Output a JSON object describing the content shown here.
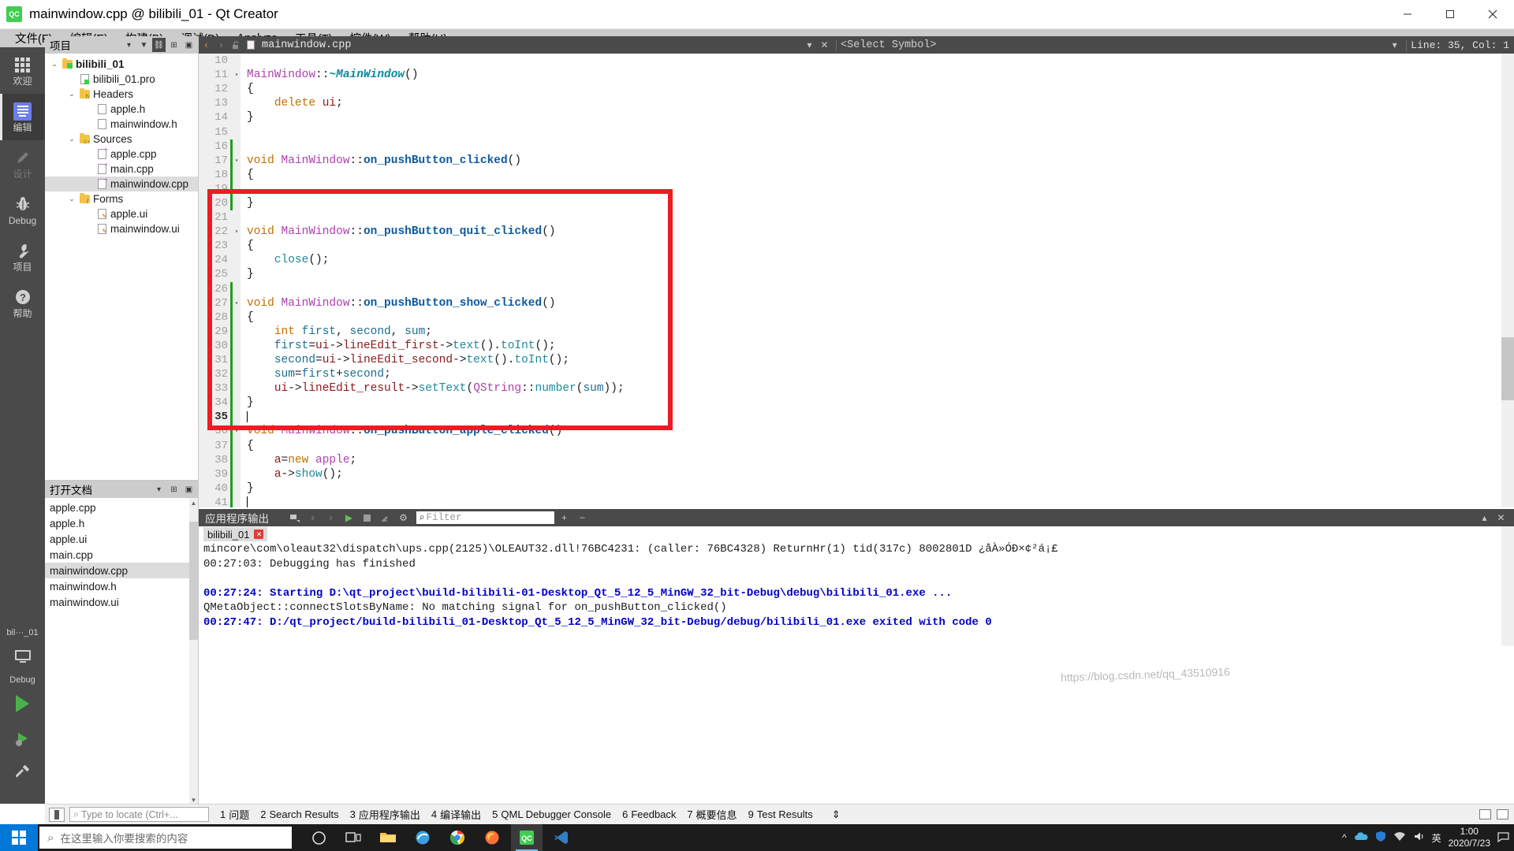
{
  "window": {
    "title": "mainwindow.cpp @ bilibili_01 - Qt Creator",
    "logo_text": "QC",
    "minimize": "—",
    "maximize": "□",
    "close": "✕"
  },
  "menubar": [
    {
      "label": "文件(F)",
      "mnemonic": "F"
    },
    {
      "label": "编辑(E)",
      "mnemonic": "E"
    },
    {
      "label": "构建(B)",
      "mnemonic": "B"
    },
    {
      "label": "调试(D)",
      "mnemonic": "D"
    },
    {
      "label": "Analyze",
      "mnemonic": "A"
    },
    {
      "label": "工具(T)",
      "mnemonic": "T"
    },
    {
      "label": "控件(W)",
      "mnemonic": "W"
    },
    {
      "label": "帮助(H)",
      "mnemonic": "H"
    }
  ],
  "modebar": {
    "items": [
      {
        "label": "欢迎",
        "icon": "grid-icon",
        "state": "normal"
      },
      {
        "label": "编辑",
        "icon": "document-lines-icon",
        "state": "active"
      },
      {
        "label": "设计",
        "icon": "pencil-icon",
        "state": "disabled"
      },
      {
        "label": "Debug",
        "icon": "bug-icon",
        "state": "normal"
      },
      {
        "label": "项目",
        "icon": "wrench-icon",
        "state": "normal"
      },
      {
        "label": "帮助",
        "icon": "question-circle-icon",
        "state": "normal"
      }
    ],
    "kit_label": "bil···_01",
    "kit_mode": "Debug"
  },
  "project_panel": {
    "header": "项目",
    "tools": [
      "filter-icon",
      "link-icon",
      "split-icon",
      "collapse-icon"
    ],
    "tree": [
      {
        "label": "bilibili_01",
        "depth": 0,
        "icon": "qt-folder-icon",
        "expander": "open",
        "bold": true,
        "selected": false
      },
      {
        "label": "bilibili_01.pro",
        "depth": 1,
        "icon": "pro-file-icon",
        "expander": "none",
        "bold": false,
        "selected": false
      },
      {
        "label": "Headers",
        "depth": 1,
        "icon": "h-folder-icon",
        "expander": "open",
        "bold": false,
        "selected": false
      },
      {
        "label": "apple.h",
        "depth": 2,
        "icon": "header-file-icon",
        "expander": "none",
        "bold": false,
        "selected": false
      },
      {
        "label": "mainwindow.h",
        "depth": 2,
        "icon": "header-file-icon",
        "expander": "none",
        "bold": false,
        "selected": false
      },
      {
        "label": "Sources",
        "depth": 1,
        "icon": "cpp-folder-icon",
        "expander": "open",
        "bold": false,
        "selected": false
      },
      {
        "label": "apple.cpp",
        "depth": 2,
        "icon": "cpp-file-icon",
        "expander": "none",
        "bold": false,
        "selected": false
      },
      {
        "label": "main.cpp",
        "depth": 2,
        "icon": "cpp-file-icon",
        "expander": "none",
        "bold": false,
        "selected": false
      },
      {
        "label": "mainwindow.cpp",
        "depth": 2,
        "icon": "cpp-file-icon",
        "expander": "none",
        "bold": false,
        "selected": true
      },
      {
        "label": "Forms",
        "depth": 1,
        "icon": "forms-folder-icon",
        "expander": "open",
        "bold": false,
        "selected": false
      },
      {
        "label": "apple.ui",
        "depth": 2,
        "icon": "ui-file-icon",
        "expander": "none",
        "bold": false,
        "selected": false
      },
      {
        "label": "mainwindow.ui",
        "depth": 2,
        "icon": "ui-file-icon",
        "expander": "none",
        "bold": false,
        "selected": false
      }
    ]
  },
  "open_documents": {
    "header": "打开文档",
    "items": [
      {
        "label": "apple.cpp",
        "selected": false
      },
      {
        "label": "apple.h",
        "selected": false
      },
      {
        "label": "apple.ui",
        "selected": false
      },
      {
        "label": "main.cpp",
        "selected": false
      },
      {
        "label": "mainwindow.cpp",
        "selected": true
      },
      {
        "label": "mainwindow.h",
        "selected": false
      },
      {
        "label": "mainwindow.ui",
        "selected": false
      }
    ]
  },
  "editor_toolbar": {
    "back": "‹",
    "forward": "›",
    "lock_icon": "unlocked-icon",
    "file_icon": "cpp-file-icon",
    "filename": "mainwindow.cpp",
    "dropdown": "▾",
    "close": "✕",
    "symbol_selector": "<Select Symbol>",
    "symbol_dropdown": "▾",
    "cursor_position": "Line: 35, Col: 1"
  },
  "code": {
    "lines": [
      {
        "num": 10,
        "fold": "",
        "changed": false,
        "tokens": []
      },
      {
        "num": 11,
        "fold": "▾",
        "changed": false,
        "tokens": [
          {
            "t": "MainWindow",
            "c": "cls"
          },
          {
            "t": "::",
            "c": "pn"
          },
          {
            "t": "~MainWindow",
            "c": "fni"
          },
          {
            "t": "()",
            "c": "pn"
          }
        ]
      },
      {
        "num": 12,
        "fold": "",
        "changed": false,
        "tokens": [
          {
            "t": "{",
            "c": "pn"
          }
        ]
      },
      {
        "num": 13,
        "fold": "",
        "changed": false,
        "tokens": [
          {
            "t": "    ",
            "c": "pn"
          },
          {
            "t": "delete",
            "c": "k"
          },
          {
            "t": " ",
            "c": "pn"
          },
          {
            "t": "ui",
            "c": "mem"
          },
          {
            "t": ";",
            "c": "pn"
          }
        ]
      },
      {
        "num": 14,
        "fold": "",
        "changed": false,
        "tokens": [
          {
            "t": "}",
            "c": "pn"
          }
        ]
      },
      {
        "num": 15,
        "fold": "",
        "changed": false,
        "tokens": []
      },
      {
        "num": 16,
        "fold": "",
        "changed": true,
        "tokens": []
      },
      {
        "num": 17,
        "fold": "▾",
        "changed": true,
        "tokens": [
          {
            "t": "void",
            "c": "k"
          },
          {
            "t": " ",
            "c": "pn"
          },
          {
            "t": "MainWindow",
            "c": "cls"
          },
          {
            "t": "::",
            "c": "pn"
          },
          {
            "t": "on_pushButton_clicked",
            "c": "fn"
          },
          {
            "t": "()",
            "c": "pn"
          }
        ]
      },
      {
        "num": 18,
        "fold": "",
        "changed": true,
        "tokens": [
          {
            "t": "{",
            "c": "pn"
          }
        ]
      },
      {
        "num": 19,
        "fold": "",
        "changed": true,
        "tokens": []
      },
      {
        "num": 20,
        "fold": "",
        "changed": true,
        "tokens": [
          {
            "t": "}",
            "c": "pn"
          }
        ]
      },
      {
        "num": 21,
        "fold": "",
        "changed": false,
        "tokens": []
      },
      {
        "num": 22,
        "fold": "▾",
        "changed": false,
        "tokens": [
          {
            "t": "void",
            "c": "k"
          },
          {
            "t": " ",
            "c": "pn"
          },
          {
            "t": "MainWindow",
            "c": "cls"
          },
          {
            "t": "::",
            "c": "pn"
          },
          {
            "t": "on_pushButton_quit_clicked",
            "c": "fn"
          },
          {
            "t": "()",
            "c": "pn"
          }
        ]
      },
      {
        "num": 23,
        "fold": "",
        "changed": false,
        "tokens": [
          {
            "t": "{",
            "c": "pn"
          }
        ]
      },
      {
        "num": 24,
        "fold": "",
        "changed": false,
        "tokens": [
          {
            "t": "    ",
            "c": "pn"
          },
          {
            "t": "close",
            "c": "cal"
          },
          {
            "t": "();",
            "c": "pn"
          }
        ]
      },
      {
        "num": 25,
        "fold": "",
        "changed": false,
        "tokens": [
          {
            "t": "}",
            "c": "pn"
          }
        ]
      },
      {
        "num": 26,
        "fold": "",
        "changed": true,
        "tokens": []
      },
      {
        "num": 27,
        "fold": "▾",
        "changed": true,
        "tokens": [
          {
            "t": "void",
            "c": "k"
          },
          {
            "t": " ",
            "c": "pn"
          },
          {
            "t": "MainWindow",
            "c": "cls"
          },
          {
            "t": "::",
            "c": "pn"
          },
          {
            "t": "on_pushButton_show_clicked",
            "c": "fn"
          },
          {
            "t": "()",
            "c": "pn"
          }
        ]
      },
      {
        "num": 28,
        "fold": "",
        "changed": true,
        "tokens": [
          {
            "t": "{",
            "c": "pn"
          }
        ]
      },
      {
        "num": 29,
        "fold": "",
        "changed": true,
        "tokens": [
          {
            "t": "    ",
            "c": "pn"
          },
          {
            "t": "int",
            "c": "k"
          },
          {
            "t": " ",
            "c": "pn"
          },
          {
            "t": "first",
            "c": "loc"
          },
          {
            "t": ", ",
            "c": "pn"
          },
          {
            "t": "second",
            "c": "loc"
          },
          {
            "t": ", ",
            "c": "pn"
          },
          {
            "t": "sum",
            "c": "loc"
          },
          {
            "t": ";",
            "c": "pn"
          }
        ]
      },
      {
        "num": 30,
        "fold": "",
        "changed": true,
        "tokens": [
          {
            "t": "    ",
            "c": "pn"
          },
          {
            "t": "first",
            "c": "loc"
          },
          {
            "t": "=",
            "c": "pn"
          },
          {
            "t": "ui",
            "c": "mem"
          },
          {
            "t": "->",
            "c": "pn"
          },
          {
            "t": "lineEdit_first",
            "c": "mem"
          },
          {
            "t": "->",
            "c": "pn"
          },
          {
            "t": "text",
            "c": "cal"
          },
          {
            "t": "().",
            "c": "pn"
          },
          {
            "t": "toInt",
            "c": "cal"
          },
          {
            "t": "();",
            "c": "pn"
          }
        ]
      },
      {
        "num": 31,
        "fold": "",
        "changed": true,
        "tokens": [
          {
            "t": "    ",
            "c": "pn"
          },
          {
            "t": "second",
            "c": "loc"
          },
          {
            "t": "=",
            "c": "pn"
          },
          {
            "t": "ui",
            "c": "mem"
          },
          {
            "t": "->",
            "c": "pn"
          },
          {
            "t": "lineEdit_second",
            "c": "mem"
          },
          {
            "t": "->",
            "c": "pn"
          },
          {
            "t": "text",
            "c": "cal"
          },
          {
            "t": "().",
            "c": "pn"
          },
          {
            "t": "toInt",
            "c": "cal"
          },
          {
            "t": "();",
            "c": "pn"
          }
        ]
      },
      {
        "num": 32,
        "fold": "",
        "changed": true,
        "tokens": [
          {
            "t": "    ",
            "c": "pn"
          },
          {
            "t": "sum",
            "c": "loc"
          },
          {
            "t": "=",
            "c": "pn"
          },
          {
            "t": "first",
            "c": "loc"
          },
          {
            "t": "+",
            "c": "pn"
          },
          {
            "t": "second",
            "c": "loc"
          },
          {
            "t": ";",
            "c": "pn"
          }
        ]
      },
      {
        "num": 33,
        "fold": "",
        "changed": true,
        "tokens": [
          {
            "t": "    ",
            "c": "pn"
          },
          {
            "t": "ui",
            "c": "mem"
          },
          {
            "t": "->",
            "c": "pn"
          },
          {
            "t": "lineEdit_result",
            "c": "mem"
          },
          {
            "t": "->",
            "c": "pn"
          },
          {
            "t": "setText",
            "c": "cal"
          },
          {
            "t": "(",
            "c": "pn"
          },
          {
            "t": "QString",
            "c": "cls"
          },
          {
            "t": "::",
            "c": "pn"
          },
          {
            "t": "number",
            "c": "cal"
          },
          {
            "t": "(",
            "c": "pn"
          },
          {
            "t": "sum",
            "c": "loc"
          },
          {
            "t": "));",
            "c": "pn"
          }
        ]
      },
      {
        "num": 34,
        "fold": "",
        "changed": true,
        "tokens": [
          {
            "t": "}",
            "c": "pn"
          }
        ]
      },
      {
        "num": 35,
        "fold": "",
        "changed": true,
        "current": true,
        "cursor": true,
        "tokens": []
      },
      {
        "num": 36,
        "fold": "▾",
        "changed": true,
        "tokens": [
          {
            "t": "void",
            "c": "k"
          },
          {
            "t": " ",
            "c": "pn"
          },
          {
            "t": "MainWindow",
            "c": "cls"
          },
          {
            "t": "::",
            "c": "pn"
          },
          {
            "t": "on_pushButton_apple_clicked",
            "c": "fn"
          },
          {
            "t": "()",
            "c": "pn"
          }
        ]
      },
      {
        "num": 37,
        "fold": "",
        "changed": true,
        "tokens": [
          {
            "t": "{",
            "c": "pn"
          }
        ]
      },
      {
        "num": 38,
        "fold": "",
        "changed": true,
        "tokens": [
          {
            "t": "    ",
            "c": "pn"
          },
          {
            "t": "a",
            "c": "mem"
          },
          {
            "t": "=",
            "c": "pn"
          },
          {
            "t": "new",
            "c": "k"
          },
          {
            "t": " ",
            "c": "pn"
          },
          {
            "t": "apple",
            "c": "cls"
          },
          {
            "t": ";",
            "c": "pn"
          }
        ]
      },
      {
        "num": 39,
        "fold": "",
        "changed": true,
        "tokens": [
          {
            "t": "    ",
            "c": "pn"
          },
          {
            "t": "a",
            "c": "mem"
          },
          {
            "t": "->",
            "c": "pn"
          },
          {
            "t": "show",
            "c": "cal"
          },
          {
            "t": "();",
            "c": "pn"
          }
        ]
      },
      {
        "num": 40,
        "fold": "",
        "changed": true,
        "tokens": [
          {
            "t": "}",
            "c": "pn"
          }
        ]
      },
      {
        "num": 41,
        "fold": "",
        "changed": true,
        "cursor": true,
        "tokens": []
      }
    ],
    "annotation_color": "#ed1c24"
  },
  "output_pane": {
    "title": "应用程序输出",
    "tools": [
      "attach-debugger-icon",
      "prev-icon",
      "next-icon",
      "run-icon",
      "stop-icon",
      "clear-icon",
      "settings-icon"
    ],
    "filter_placeholder": "Filter",
    "add_label": "+",
    "remove_label": "−",
    "maximize": "▴",
    "close": "✕",
    "tab": {
      "label": "bilibili_01",
      "close_icon": "close-icon"
    },
    "lines": [
      {
        "text": "mincore\\com\\oleaut32\\dispatch\\ups.cpp(2125)\\OLEAUT32.dll!76BC4231: (caller: 76BC4328) ReturnHr(1) tid(317c) 8002801D ¿åÀ»ÓÐ×¢²á¡£",
        "bold": false
      },
      {
        "text": "00:27:03: Debugging has finished",
        "bold": false
      },
      {
        "text": "",
        "bold": false
      },
      {
        "text": "00:27:24: Starting D:\\qt_project\\build-bilibili-01-Desktop_Qt_5_12_5_MinGW_32_bit-Debug\\debug\\bilibili_01.exe ...",
        "bold": true
      },
      {
        "text": "QMetaObject::connectSlotsByName: No matching signal for on_pushButton_clicked()",
        "bold": false
      },
      {
        "text": "00:27:47: D:/qt_project/build-bilibili_01-Desktop_Qt_5_12_5_MinGW_32_bit-Debug/debug/bilibili_01.exe exited with code 0",
        "bold": true
      }
    ]
  },
  "statusbar": {
    "locator_placeholder": "Type to locate (Ctrl+...",
    "tabs": [
      {
        "num": "1",
        "label": "问题"
      },
      {
        "num": "2",
        "label": "Search Results"
      },
      {
        "num": "3",
        "label": "应用程序输出"
      },
      {
        "num": "4",
        "label": "编译输出"
      },
      {
        "num": "5",
        "label": "QML Debugger Console"
      },
      {
        "num": "6",
        "label": "Feedback"
      },
      {
        "num": "7",
        "label": "概要信息"
      },
      {
        "num": "9",
        "label": "Test Results"
      }
    ],
    "resize_handle": "⇕"
  },
  "taskbar": {
    "search_placeholder": "在这里输入你要搜索的内容",
    "items": [
      {
        "name": "cortana-icon"
      },
      {
        "name": "task-view-icon"
      },
      {
        "name": "file-explorer-icon"
      },
      {
        "name": "browser-icon"
      },
      {
        "name": "chrome-icon"
      },
      {
        "name": "firefox-icon"
      },
      {
        "name": "qt-creator-icon"
      },
      {
        "name": "vscode-icon"
      }
    ],
    "tray": {
      "ime": "英",
      "time": "1:00",
      "date": "2020/7/23"
    }
  },
  "watermark": "https://blog.csdn.net/qq_43510916"
}
